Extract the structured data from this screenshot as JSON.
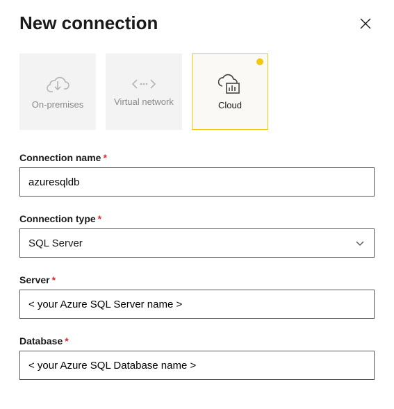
{
  "header": {
    "title": "New connection"
  },
  "tiles": {
    "on_premises": "On-premises",
    "virtual_network": "Virtual network",
    "cloud": "Cloud"
  },
  "fields": {
    "connection_name": {
      "label": "Connection name",
      "value": "azuresqldb"
    },
    "connection_type": {
      "label": "Connection type",
      "value": "SQL Server"
    },
    "server": {
      "label": "Server",
      "value": "< your Azure SQL Server name >"
    },
    "database": {
      "label": "Database",
      "value": "< your Azure SQL Database name >"
    }
  },
  "required_mark": "*"
}
